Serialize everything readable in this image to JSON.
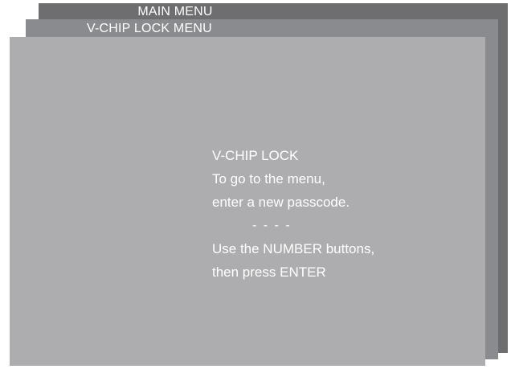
{
  "menus": {
    "main_title": "MAIN MENU",
    "vchip_title": "V-CHIP LOCK MENU"
  },
  "dialog": {
    "heading": "V-CHIP LOCK",
    "line1": "To go to the menu,",
    "line2": "enter a new passcode.",
    "passcode_placeholder": "- - - -",
    "instruction1": "Use the NUMBER buttons,",
    "instruction2": "then press ENTER"
  },
  "colors": {
    "main_menu_panel": "#6e6e71",
    "vchip_menu_panel": "#8a8b8e",
    "front_panel": "#adadb0",
    "text": "#ffffff"
  }
}
